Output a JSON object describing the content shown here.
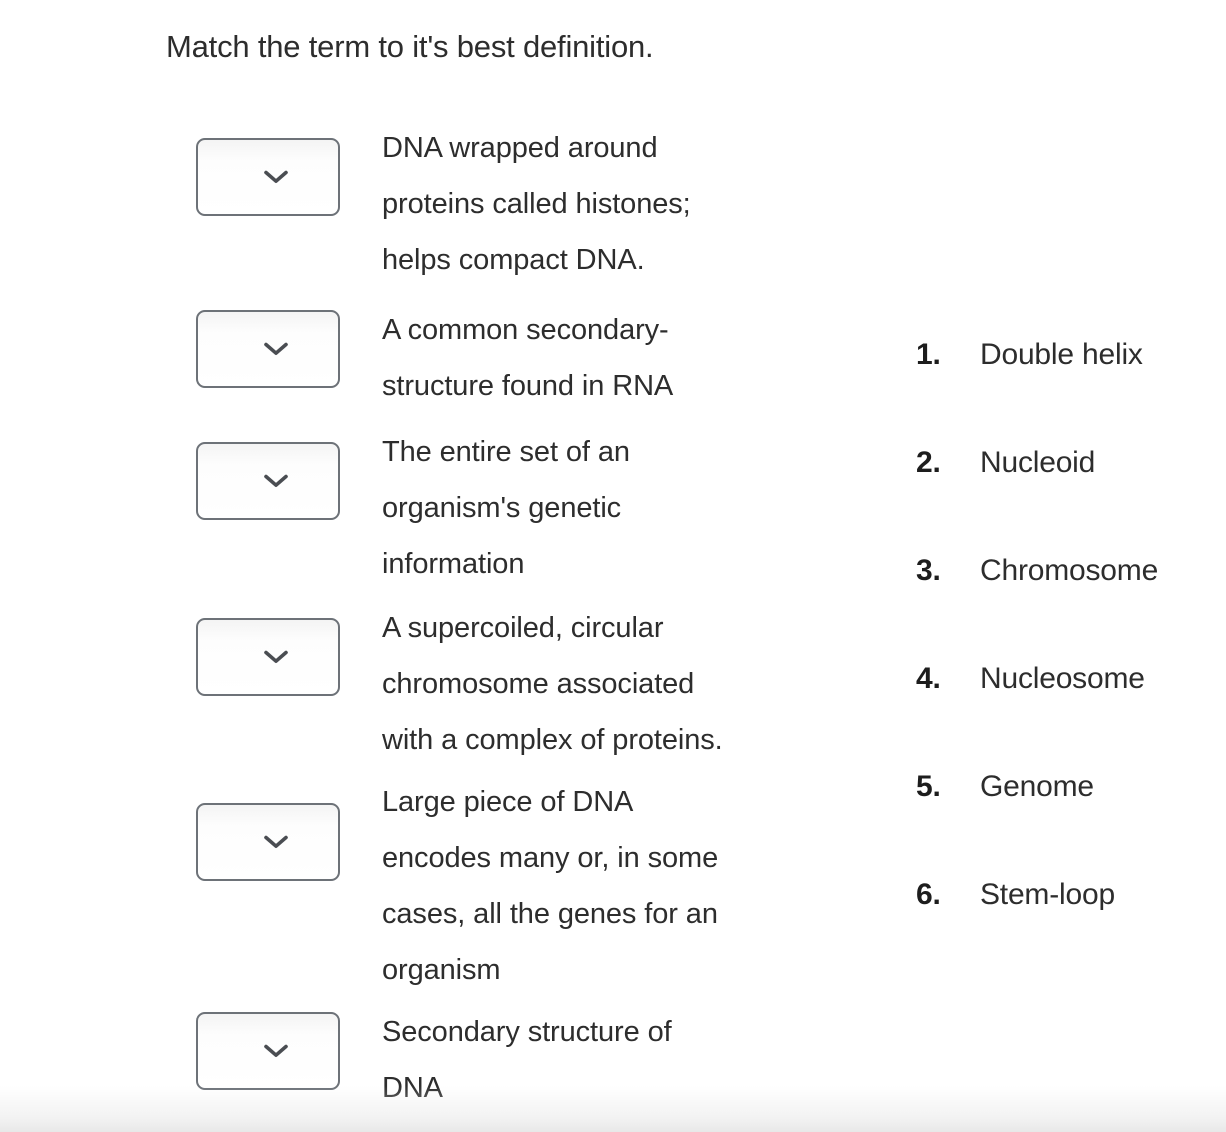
{
  "prompt": "Match the term to it's best definition.",
  "dropdown": {
    "icon": "chevron-down-icon",
    "selected_value": "",
    "placeholder": ""
  },
  "items": [
    {
      "id": 1,
      "selected": "",
      "definition": "DNA wrapped around proteins called histones; helps compact DNA.",
      "lines": [
        "DNA wrapped around",
        "proteins called histones;",
        "helps compact DNA."
      ]
    },
    {
      "id": 2,
      "selected": "",
      "definition": "A common secondary-structure found in RNA",
      "lines": [
        "A common secondary-",
        "structure found in RNA"
      ]
    },
    {
      "id": 3,
      "selected": "",
      "definition": "The entire set of an organism's genetic information",
      "lines": [
        "The entire set of an",
        "organism's genetic",
        "information"
      ]
    },
    {
      "id": 4,
      "selected": "",
      "definition": "A supercoiled, circular chromosome associated with a complex of proteins.",
      "lines": [
        "A supercoiled, circular",
        "chromosome associated",
        "with a complex of proteins."
      ]
    },
    {
      "id": 5,
      "selected": "",
      "definition": "Large piece of DNA encodes many or, in some cases, all the genes for an organism",
      "lines": [
        "Large piece of DNA",
        "encodes many or, in some",
        "cases, all the genes for an",
        "organism"
      ]
    },
    {
      "id": 6,
      "selected": "",
      "definition": "Secondary structure of DNA",
      "lines": [
        "Secondary structure of",
        "DNA"
      ]
    }
  ],
  "options": [
    {
      "num": "1.",
      "label": "Double helix"
    },
    {
      "num": "2.",
      "label": "Nucleoid"
    },
    {
      "num": "3.",
      "label": "Chromosome"
    },
    {
      "num": "4.",
      "label": "Nucleosome"
    },
    {
      "num": "5.",
      "label": "Genome"
    },
    {
      "num": "6.",
      "label": "Stem-loop"
    }
  ],
  "colors": {
    "text": "#2d2d2d",
    "dropdown_border": "#6d7278",
    "chevron": "#4a4d52",
    "background": "#ffffff"
  }
}
